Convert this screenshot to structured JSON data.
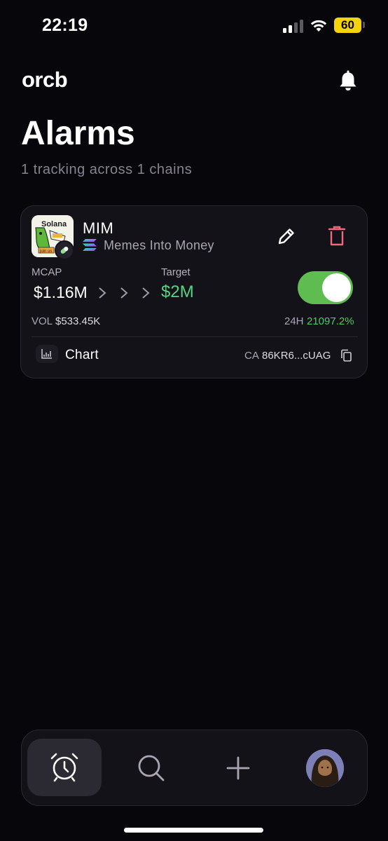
{
  "status_bar": {
    "time": "22:19",
    "battery": "60"
  },
  "header": {
    "brand": "orcb",
    "title": "Alarms",
    "subtitle": "1 tracking across 1 chains"
  },
  "alarm_card": {
    "token_symbol": "MIM",
    "token_name": "Memes Into Money",
    "chain_icon": "solana-logo",
    "mcap_label": "MCAP",
    "mcap_value": "$1.16M",
    "target_label": "Target",
    "target_value": "$2M",
    "toggle_on": true,
    "vol_label": "VOL",
    "vol_value": "$533.45K",
    "change_label": "24H",
    "change_value": "21097.2%",
    "chart_label": "Chart",
    "ca_label": "CA",
    "ca_value": "86KR6...cUAG"
  },
  "nav": {
    "items": [
      {
        "name": "alarms",
        "icon": "alarm-clock-icon",
        "active": true
      },
      {
        "name": "search",
        "icon": "search-icon",
        "active": false
      },
      {
        "name": "add",
        "icon": "plus-icon",
        "active": false
      },
      {
        "name": "profile",
        "icon": "avatar",
        "active": false
      }
    ]
  },
  "colors": {
    "background": "#07060b",
    "card": "#141219",
    "accent_green": "#55d584",
    "toggle_green": "#5ebc51",
    "delete_red": "#ef6a78",
    "muted_text": "#86838f"
  }
}
